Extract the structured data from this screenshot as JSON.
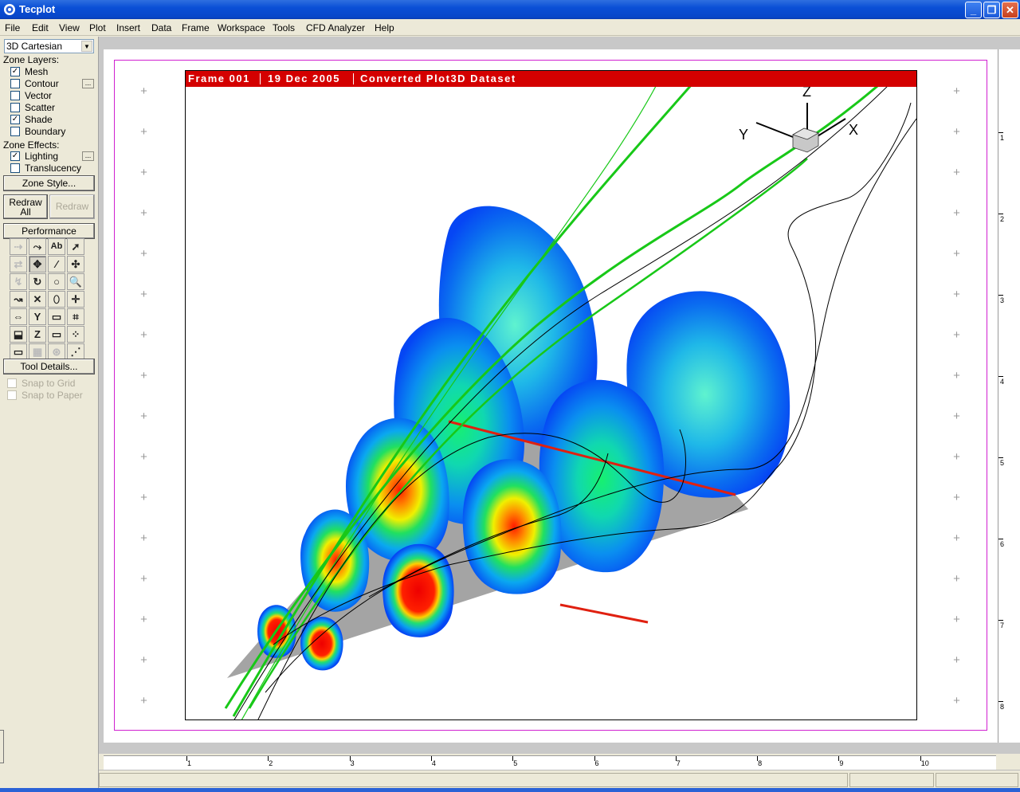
{
  "window": {
    "title": "Tecplot",
    "minimize": "_",
    "maximize": "❐",
    "close": "✕"
  },
  "menu": [
    "File",
    "Edit",
    "View",
    "Plot",
    "Insert",
    "Data",
    "Frame",
    "Workspace",
    "Tools",
    "CFD Analyzer",
    "Help"
  ],
  "left_panel": {
    "plot_type": "3D Cartesian",
    "zone_layers_label": "Zone Layers:",
    "layers": [
      {
        "label": "Mesh",
        "checked": true
      },
      {
        "label": "Contour",
        "checked": false
      },
      {
        "label": "Vector",
        "checked": false
      },
      {
        "label": "Scatter",
        "checked": false
      },
      {
        "label": "Shade",
        "checked": true
      },
      {
        "label": "Boundary",
        "checked": false
      }
    ],
    "zone_effects_label": "Zone Effects:",
    "effects": [
      {
        "label": "Lighting",
        "checked": true
      },
      {
        "label": "Translucency",
        "checked": false
      }
    ],
    "zone_style_button": "Zone Style...",
    "redraw_all_button_line1": "Redraw",
    "redraw_all_button_line2": "All",
    "redraw_button": "Redraw",
    "performance_button": "Performance",
    "tool_details_button": "Tool Details...",
    "snap_grid": "Snap to Grid",
    "snap_paper": "Snap to Paper",
    "tools": [
      "⇢",
      "⤳",
      "Ab",
      "➚",
      "⇄",
      "✥",
      "∕",
      "✣",
      "↯",
      "↻",
      "○",
      "🔍",
      "↝",
      "✕",
      "⬯",
      "✛",
      "⇔",
      "Y",
      "▭",
      "⌗",
      "⬓",
      "Z",
      "▭",
      "⁘",
      "▭",
      "▦",
      "⊛",
      "⋰"
    ]
  },
  "frame": {
    "name": "Frame 001",
    "date": "19 Dec 2005",
    "dataset": "Converted Plot3D Dataset"
  },
  "axes_triad": {
    "z": "Z",
    "y": "Y",
    "x": "X"
  },
  "rulers": {
    "horizontal": [
      "1",
      "2",
      "3",
      "4",
      "5",
      "6",
      "7",
      "8",
      "9",
      "10"
    ],
    "vertical": [
      "1",
      "2",
      "3",
      "4",
      "5",
      "6",
      "7",
      "8"
    ]
  },
  "colors": {
    "frame_header": "#d40000",
    "paper_border": "#d020d0",
    "shade_gray": "#a0a0a0"
  }
}
